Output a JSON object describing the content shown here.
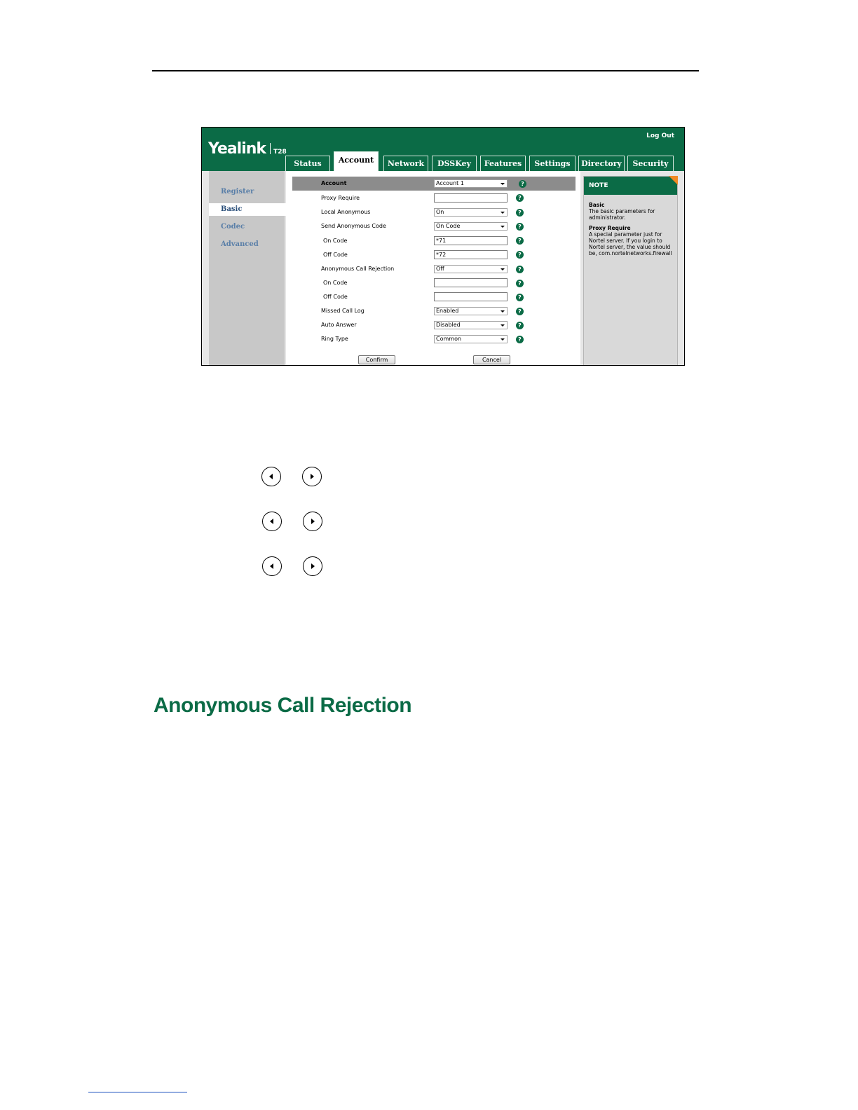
{
  "header": {
    "logo": "Yealink",
    "model": "T28",
    "logout": "Log Out"
  },
  "tabs": [
    {
      "label": "Status"
    },
    {
      "label": "Account",
      "active": true
    },
    {
      "label": "Network"
    },
    {
      "label": "DSSKey"
    },
    {
      "label": "Features"
    },
    {
      "label": "Settings"
    },
    {
      "label": "Directory"
    },
    {
      "label": "Security"
    }
  ],
  "leftnav": [
    {
      "label": "Register"
    },
    {
      "label": "Basic",
      "active": true
    },
    {
      "label": "Codec"
    },
    {
      "label": "Advanced"
    }
  ],
  "form": {
    "account_label": "Account",
    "account_value": "Account 1",
    "rows": [
      {
        "label": "Proxy Require",
        "type": "input",
        "value": ""
      },
      {
        "label": "Local Anonymous",
        "type": "select",
        "value": "On"
      },
      {
        "label": "Send Anonymous Code",
        "type": "select",
        "value": "On Code"
      },
      {
        "label": "On Code",
        "type": "input",
        "value": "*71"
      },
      {
        "label": "Off Code",
        "type": "input",
        "value": "*72"
      },
      {
        "label": "Anonymous Call Rejection",
        "type": "select",
        "value": "Off"
      },
      {
        "label": "On Code",
        "type": "input",
        "value": ""
      },
      {
        "label": "Off Code",
        "type": "input",
        "value": ""
      },
      {
        "label": "Missed Call Log",
        "type": "select",
        "value": "Enabled"
      },
      {
        "label": "Auto Answer",
        "type": "select",
        "value": "Disabled"
      },
      {
        "label": "Ring Type",
        "type": "select",
        "value": "Common"
      }
    ],
    "confirm": "Confirm",
    "cancel": "Cancel",
    "help_glyph": "?"
  },
  "note": {
    "title": "NOTE",
    "sections": [
      {
        "heading": "Basic",
        "text": "The basic parameters for administrator."
      },
      {
        "heading": "Proxy Require",
        "text": "A special parameter just for Nortel server. If you login to Nortel server, the value should be, com.nortelnetworks.firewall"
      }
    ]
  },
  "section_title": "Anonymous Call Rejection"
}
